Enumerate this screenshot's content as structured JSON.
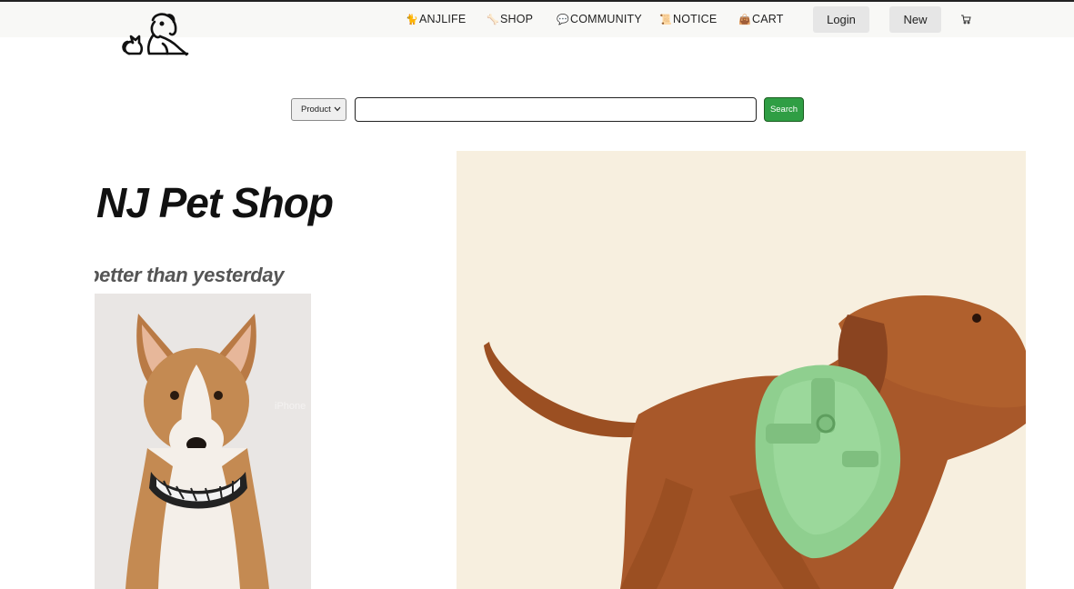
{
  "header": {
    "nav": [
      {
        "icon": "cat-icon",
        "glyph": "🐈",
        "label": "ANJLIFE"
      },
      {
        "icon": "bone-icon",
        "glyph": "🦴",
        "label": "SHOP"
      },
      {
        "icon": "speech-bubble-icon",
        "glyph": "💬",
        "label": "COMMUNITY"
      },
      {
        "icon": "notice-board-icon",
        "glyph": "📜",
        "label": "NOTICE"
      },
      {
        "icon": "bag-icon",
        "glyph": "👜",
        "label": "CART"
      }
    ],
    "login_label": "Login",
    "new_label": "New",
    "cart_icon": "cart-icon"
  },
  "search": {
    "category_selected": "Product",
    "value": "",
    "placeholder": "",
    "button_label": "Search"
  },
  "hero": {
    "title": "NJ Pet Shop",
    "slogan": "better than yesterday",
    "card_watermark": "iPhone"
  },
  "colors": {
    "header_bg": "#f8f8f6",
    "search_button": "#2f9e44",
    "hero_bg": "#f7efdf",
    "card_bg": "#e9e6e4"
  }
}
